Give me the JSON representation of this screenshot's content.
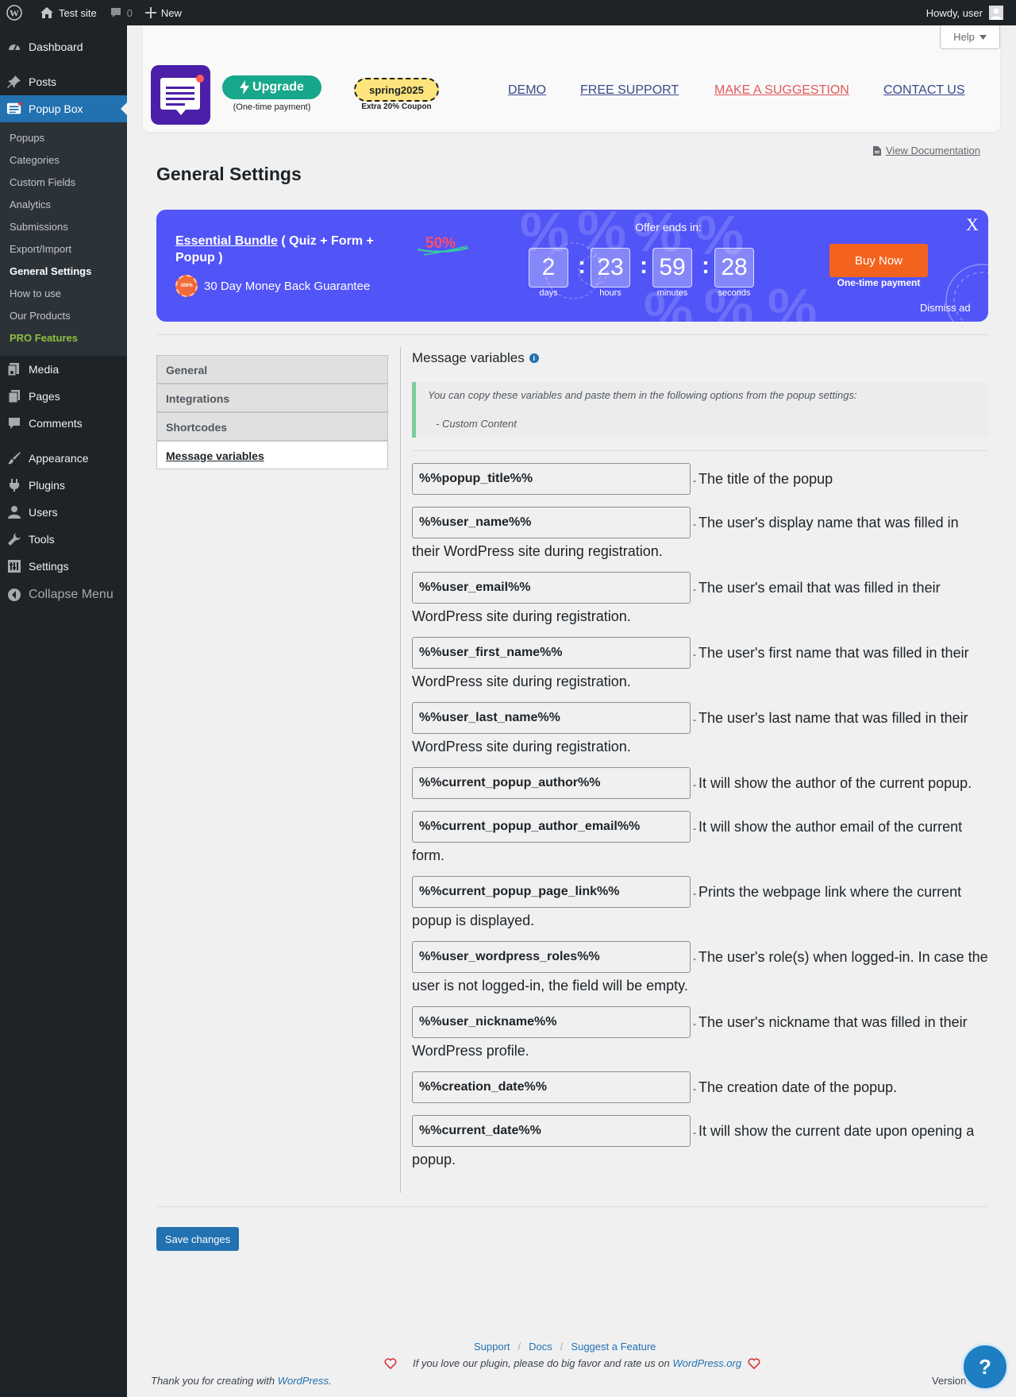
{
  "adminbar": {
    "site_name": "Test site",
    "comments_count": "0",
    "new_label": "New",
    "howdy": "Howdy, user"
  },
  "sidebar": {
    "items_top": [
      {
        "label": "Dashboard",
        "icon": "dashboard-icon"
      },
      {
        "label": "Posts",
        "icon": "pin-icon"
      },
      {
        "label": "Popup Box",
        "icon": "popup-box-icon"
      }
    ],
    "submenu": [
      "Popups",
      "Categories",
      "Custom Fields",
      "Analytics",
      "Submissions",
      "Export/Import",
      "General Settings",
      "How to use",
      "Our Products",
      "PRO Features"
    ],
    "items_bottom": [
      {
        "label": "Media",
        "icon": "media-icon"
      },
      {
        "label": "Pages",
        "icon": "pages-icon"
      },
      {
        "label": "Comments",
        "icon": "comment-icon"
      },
      {
        "label": "Appearance",
        "icon": "brush-icon"
      },
      {
        "label": "Plugins",
        "icon": "plug-icon"
      },
      {
        "label": "Users",
        "icon": "user-icon"
      },
      {
        "label": "Tools",
        "icon": "wrench-icon"
      },
      {
        "label": "Settings",
        "icon": "settings-icon"
      },
      {
        "label": "Collapse Menu",
        "icon": "collapse-icon"
      }
    ]
  },
  "help_label": "Help",
  "header": {
    "upgrade_label": "Upgrade",
    "onetime": "(One-time payment)",
    "coupon_code": "spring2025",
    "coupon_sub": "Extra 20% Coupon",
    "links": [
      "DEMO",
      "FREE SUPPORT",
      "MAKE A SUGGESTION",
      "CONTACT US"
    ]
  },
  "view_doc": "View Documentation",
  "page_title": "General Settings",
  "promo": {
    "bundle_name": "Essential Bundle",
    "bundle_rest": " ( Quiz + Form + Popup )",
    "guarantee": "30 Day Money Back Guarantee",
    "badge_text": "100%",
    "discount": "50%",
    "offer_label": "Offer ends in:",
    "countdown": [
      {
        "value": "2",
        "label": "days"
      },
      {
        "value": "23",
        "label": "hours"
      },
      {
        "value": "59",
        "label": "minutes"
      },
      {
        "value": "28",
        "label": "seconds"
      }
    ],
    "buy_label": "Buy Now",
    "buy_sub": "One-time payment",
    "close": "X",
    "dismiss": "Dismiss ad"
  },
  "tabs": [
    "General",
    "Integrations",
    "Shortcodes",
    "Message variables"
  ],
  "message_variables": {
    "title": "Message variables",
    "notice": "You can copy these variables and paste them in the following options from the popup settings:",
    "notice_item": "- Custom Content",
    "items": [
      {
        "var": "%%popup_title%%",
        "desc": "The title of the popup"
      },
      {
        "var": "%%user_name%%",
        "desc": "The user's display name that was filled in their WordPress site during registration."
      },
      {
        "var": "%%user_email%%",
        "desc": "The user's email that was filled in their WordPress site during registration."
      },
      {
        "var": "%%user_first_name%%",
        "desc": "The user's first name that was filled in their WordPress site during registration."
      },
      {
        "var": "%%user_last_name%%",
        "desc": "The user's last name that was filled in their WordPress site during registration."
      },
      {
        "var": "%%current_popup_author%%",
        "desc": "It will show the author of the current popup."
      },
      {
        "var": "%%current_popup_author_email%%",
        "desc": "It will show the author email of the current form."
      },
      {
        "var": "%%current_popup_page_link%%",
        "desc": "Prints the webpage link where the current popup is displayed."
      },
      {
        "var": "%%user_wordpress_roles%%",
        "desc": "The user's role(s) when logged-in. In case the user is not logged-in, the field will be empty."
      },
      {
        "var": "%%user_nickname%%",
        "desc": "The user's nickname that was filled in their WordPress profile."
      },
      {
        "var": "%%creation_date%%",
        "desc": "The creation date of the popup."
      },
      {
        "var": "%%current_date%%",
        "desc": "It will show the current date upon opening a popup."
      }
    ]
  },
  "save_label": "Save changes",
  "footer": {
    "links": [
      "Support",
      "Docs",
      "Suggest a Feature"
    ],
    "rate_text": "If you love our plugin, please do big favor and rate us on",
    "rate_link": "WordPress.org",
    "thanks_text": "Thank you for creating with",
    "thanks_link": "WordPress",
    "version": "Version"
  },
  "colors": {
    "accent": "#2271b1",
    "promo_bg": "#5154f7",
    "buy_btn": "#f4631e",
    "upgrade_btn": "#17a78b",
    "pro_features": "#8fc13e"
  }
}
